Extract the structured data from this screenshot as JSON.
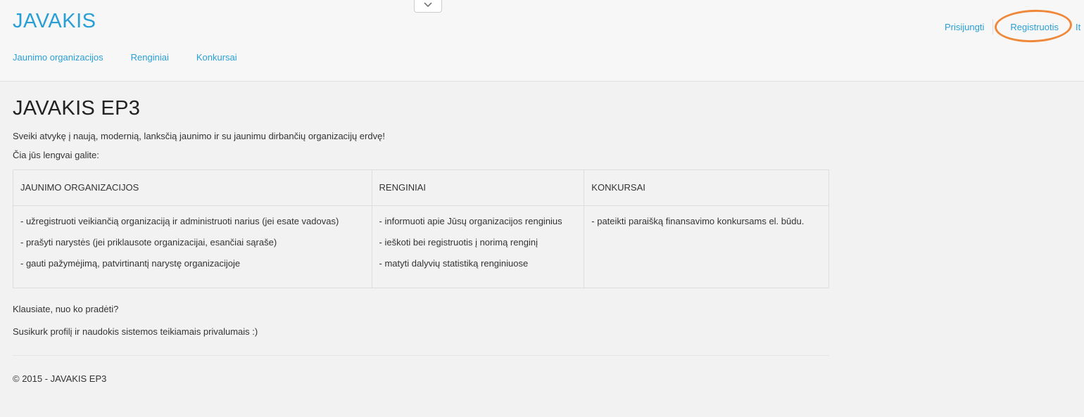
{
  "header": {
    "brand": "JAVAKIS",
    "nav": [
      {
        "label": "Jaunimo organizacijos"
      },
      {
        "label": "Renginiai"
      },
      {
        "label": "Konkursai"
      }
    ],
    "login_label": "Prisijungti",
    "register_label": "Registruotis",
    "language_partial": "It",
    "collapse_icon": "chevron-down-icon",
    "highlight_color": "#f0883a",
    "accent_color": "#2a9fd6"
  },
  "main": {
    "title": "JAVAKIS EP3",
    "lead": "Sveiki atvykę į naują, modernią, lanksčią jaunimo ir su jaunimu dirbančių organizacijų erdvę!",
    "sub": "Čia jūs lengvai galite:",
    "table": {
      "headers": [
        "JAUNIMO ORGANIZACIJOS",
        "RENGINIAI",
        "KONKURSAI"
      ],
      "columns": [
        [
          "- užregistruoti veikiančią organizaciją ir administruoti narius (jei esate vadovas)",
          "- prašyti narystės (jei priklausote organizacijai, esančiai sąraše)",
          "- gauti pažymėjimą, patvirtinantį narystę organizacijoje"
        ],
        [
          "- informuoti apie Jūsų organizacijos renginius",
          "- ieškoti bei registruotis į norimą renginį",
          "- matyti dalyvių statistiką renginiuose"
        ],
        [
          "- pateikti paraišką finansavimo konkursams el. būdu."
        ]
      ]
    },
    "outro_question": "Klausiate, nuo ko pradėti?",
    "outro_cta": "Susikurk profilį ir naudokis sistemos teikiamais privalumais :)"
  },
  "footer": {
    "copyright": "© 2015 - JAVAKIS EP3"
  }
}
